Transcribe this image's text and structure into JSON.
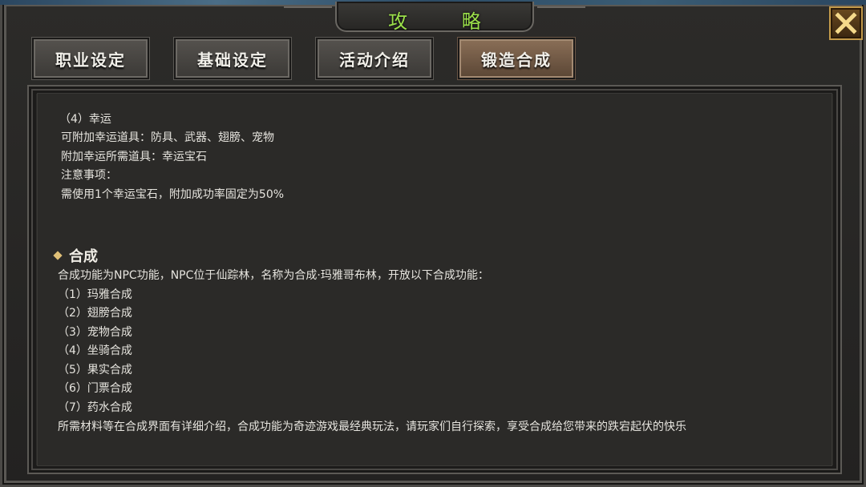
{
  "window": {
    "title": "攻 略",
    "close_icon": "close-x-icon"
  },
  "tabs": [
    {
      "label": "职业设定"
    },
    {
      "label": "基础设定"
    },
    {
      "label": "活动介绍"
    },
    {
      "label": "锻造合成",
      "active": true
    }
  ],
  "content": {
    "lucky": {
      "title": "（4）幸运",
      "line1": "可附加幸运道具：防具、武器、翅膀、宠物",
      "line2": "附加幸运所需道具：幸运宝石",
      "line3": "注意事项：",
      "line4": "需使用1个幸运宝石，附加成功率固定为50%"
    },
    "synthesis": {
      "heading": "合成",
      "intro": "合成功能为NPC功能，NPC位于仙踪林，名称为合成·玛雅哥布林，开放以下合成功能：",
      "items": [
        "（1）玛雅合成",
        "（2）翅膀合成",
        "（3）宠物合成",
        "（4）坐骑合成",
        "（5）果实合成",
        "（6）门票合成",
        "（7）药水合成"
      ],
      "footer": "所需材料等在合成界面有详细介绍，合成功能为奇迹游戏最经典玩法，请玩家们自行探索，享受合成给您带来的跌宕起伏的快乐"
    }
  },
  "colors": {
    "title_green": "#9be04a",
    "diamond_gold": "#e0c077",
    "close_gold": "#c39a4a"
  }
}
